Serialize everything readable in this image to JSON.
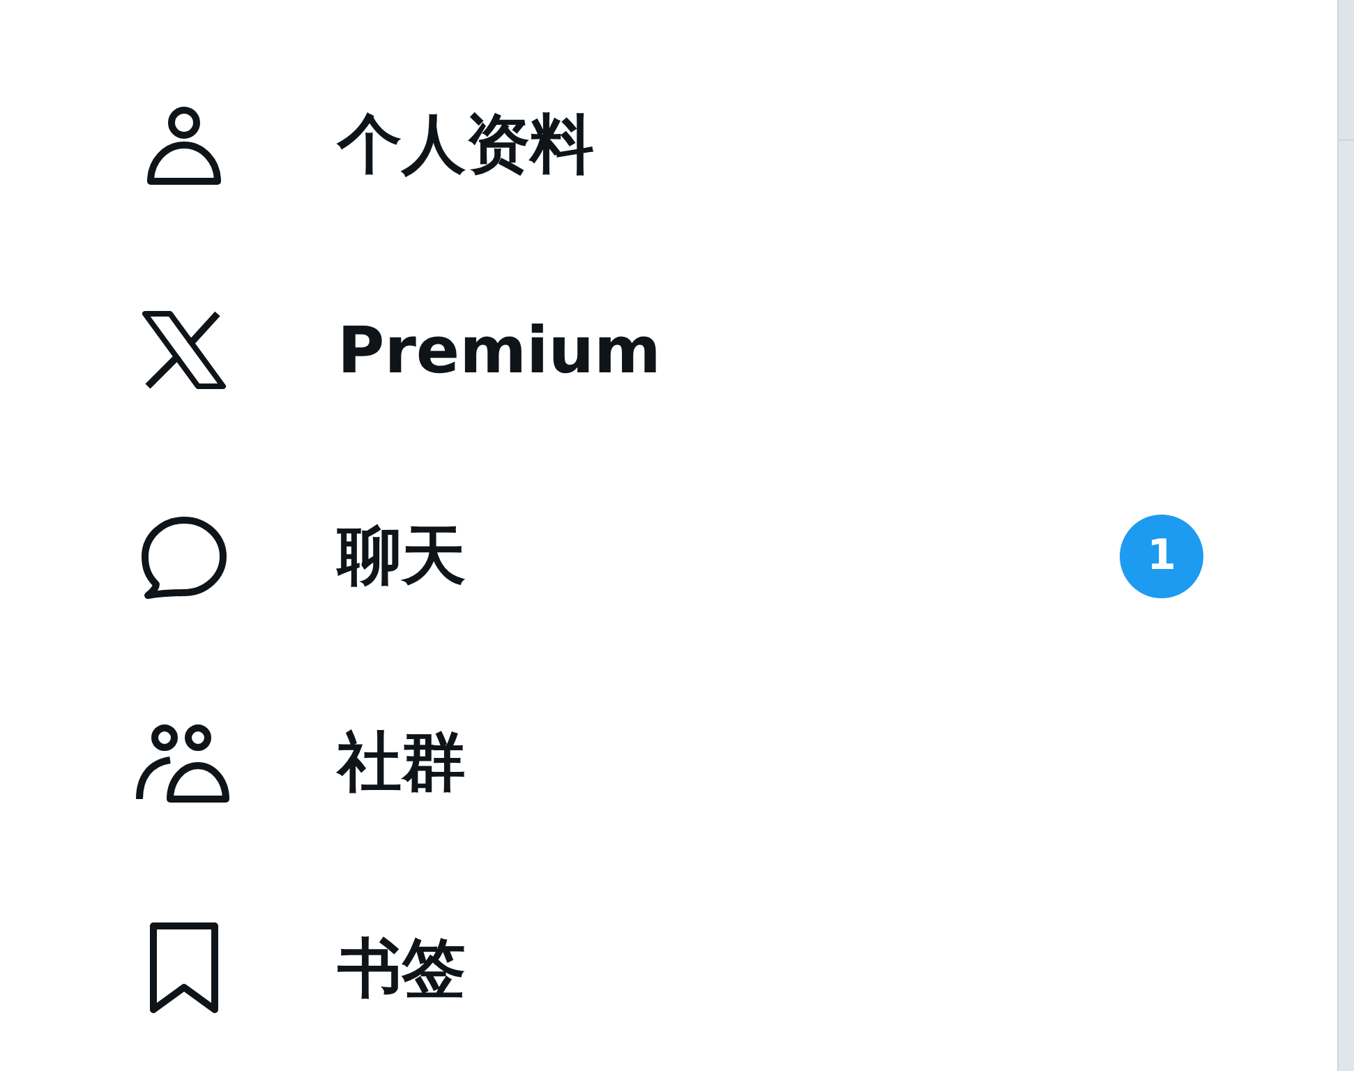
{
  "menu": {
    "items": [
      {
        "kind": "profile",
        "label": "个人资料"
      },
      {
        "kind": "premium",
        "label": "Premium"
      },
      {
        "kind": "chat",
        "label": "聊天",
        "badge": "1"
      },
      {
        "kind": "communities",
        "label": "社群"
      },
      {
        "kind": "bookmarks",
        "label": "书签"
      }
    ]
  }
}
